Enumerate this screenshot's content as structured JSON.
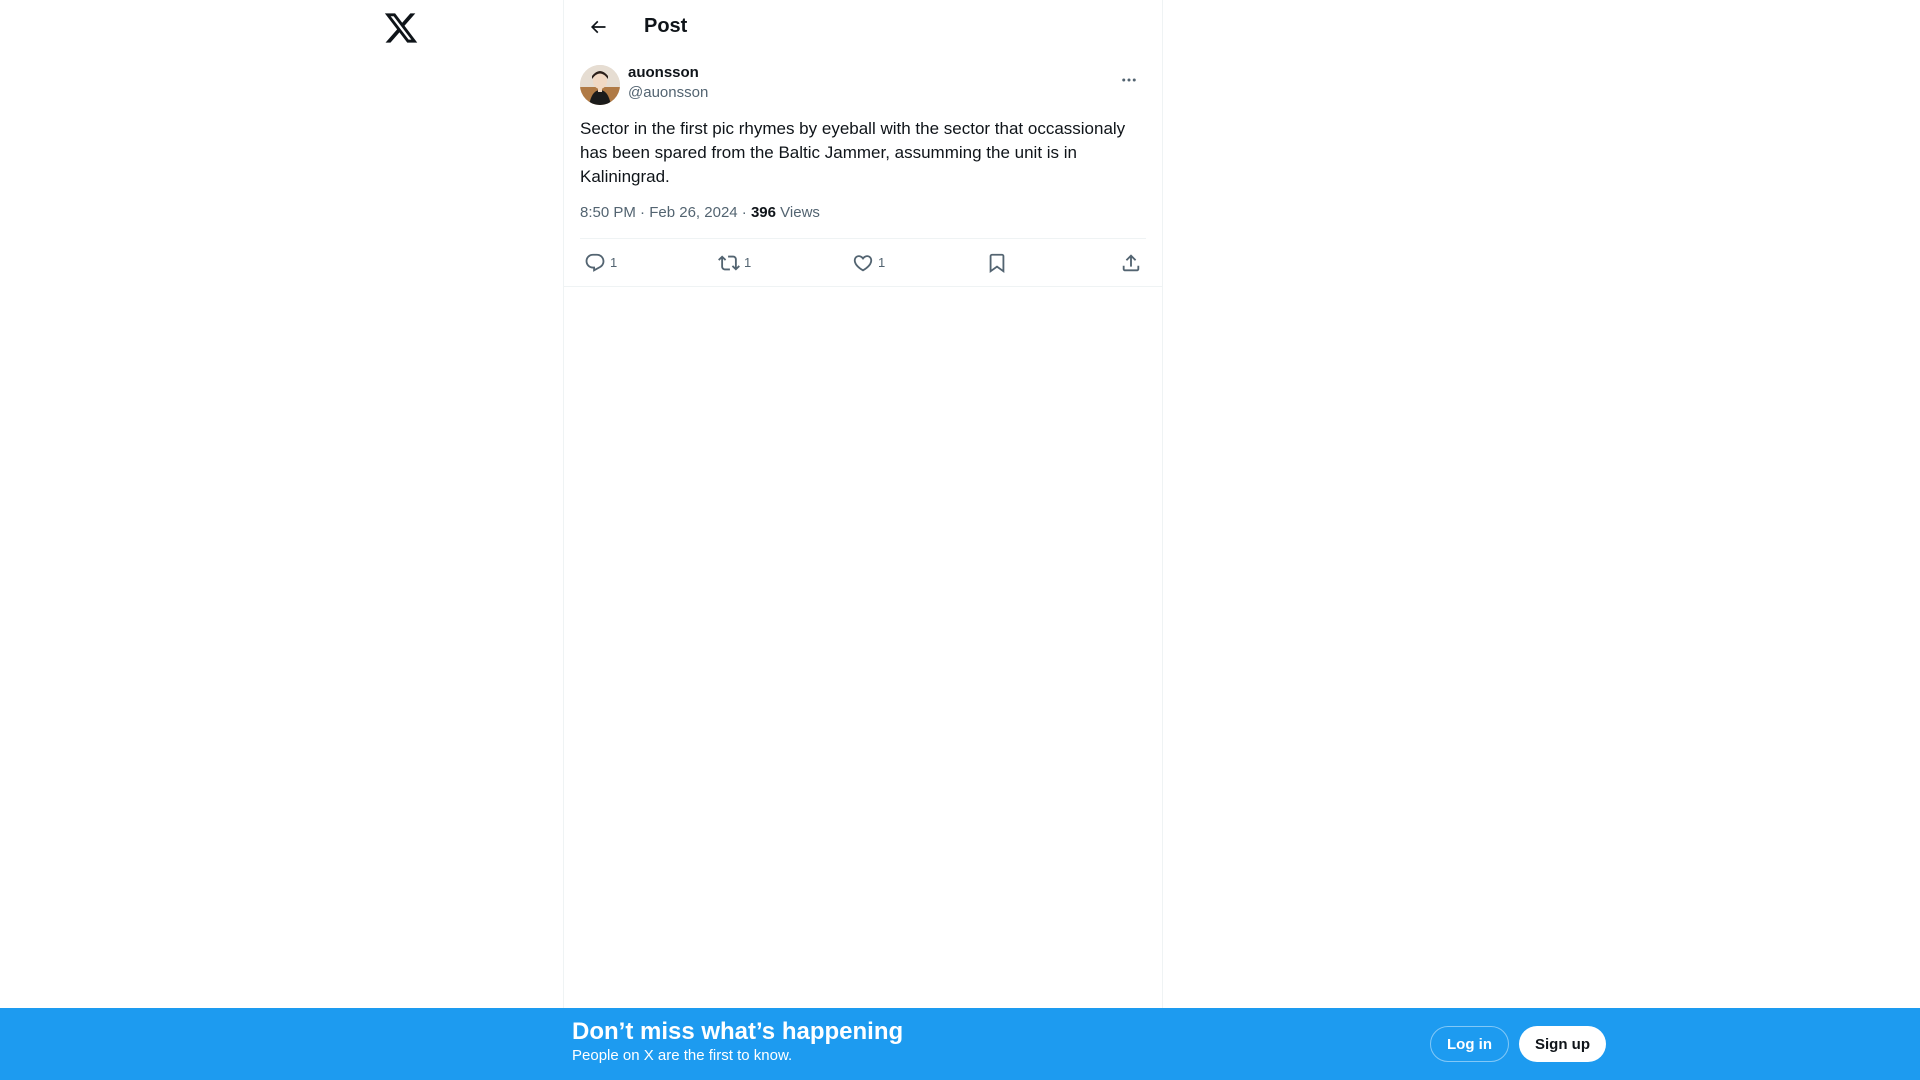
{
  "header": {
    "title": "Post"
  },
  "post": {
    "author_name": "auonsson",
    "author_handle": "@auonsson",
    "text": "Sector in the first pic rhymes by eyeball with the sector that occassionaly has been spared from the Baltic Jammer, assumming the unit is in Kaliningrad.",
    "time": "8:50 PM",
    "date": "Feb 26, 2024",
    "views_count": "396",
    "views_label": "Views",
    "separator": " · "
  },
  "actions": {
    "reply_count": "1",
    "repost_count": "1",
    "like_count": "1"
  },
  "icons": {
    "logo": "x-logo-icon",
    "back": "arrow-left-icon",
    "more": "more-horizontal-icon",
    "reply": "reply-icon",
    "repost": "repost-icon",
    "like": "heart-icon",
    "bookmark": "bookmark-icon",
    "share": "share-icon"
  },
  "bottom_bar": {
    "title": "Don’t miss what’s happening",
    "subtitle": "People on X are the first to know.",
    "login_label": "Log in",
    "signup_label": "Sign up"
  },
  "colors": {
    "accent": "#1d9bf0",
    "text_primary": "#0f1419",
    "text_secondary": "#536471",
    "border": "#eff3f4"
  }
}
